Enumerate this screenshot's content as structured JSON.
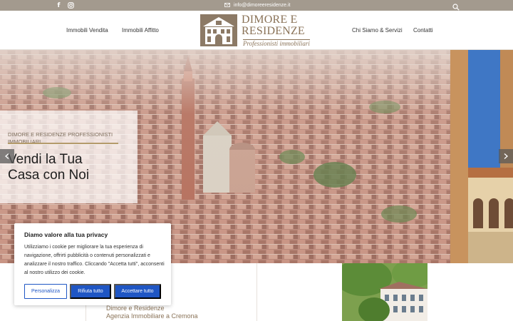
{
  "topbar": {
    "email": "info@dimoreeresidenze.it",
    "icons": [
      "facebook-icon",
      "instagram-icon",
      "mail-icon",
      "search-icon"
    ],
    "bg_color": "#a39a8e"
  },
  "nav": {
    "items": [
      {
        "label": "Immobili Vendita"
      },
      {
        "label": "Immobili Affitto"
      },
      {
        "label": "Chi Siamo & Servizi"
      },
      {
        "label": "Contatti"
      }
    ]
  },
  "logo": {
    "name_line1": "DIMORE E",
    "name_line2": "RESIDENZE",
    "tagline": "Professionisti immobiliari",
    "color": "#8a7358"
  },
  "hero": {
    "kicker": "DIMORE E RESIDENZE PROFESSIONISTI IMMOBILIARI",
    "title_line1": "Vendi la Tua",
    "title_line2": "Casa con Noi",
    "accent_color": "#b49b6b"
  },
  "section": {
    "subtitle_line1": "Dimore e Residenze",
    "subtitle_line2": "Agenzia Immobiliare a Cremona"
  },
  "cookie": {
    "title": "Diamo valore alla tua privacy",
    "text": "Utilizziamo i cookie per migliorare la tua esperienza di navigazione, offrirti pubblicità o contenuti personalizzati e analizzare il nostro traffico. Cliccando \"Accetta tutti\", acconsenti al nostro utilizzo dei cookie.",
    "buttons": {
      "customize": "Personalizza",
      "reject": "Rifiuta tutto",
      "accept": "Accettare tutto"
    },
    "button_color": "#1f56c4"
  }
}
